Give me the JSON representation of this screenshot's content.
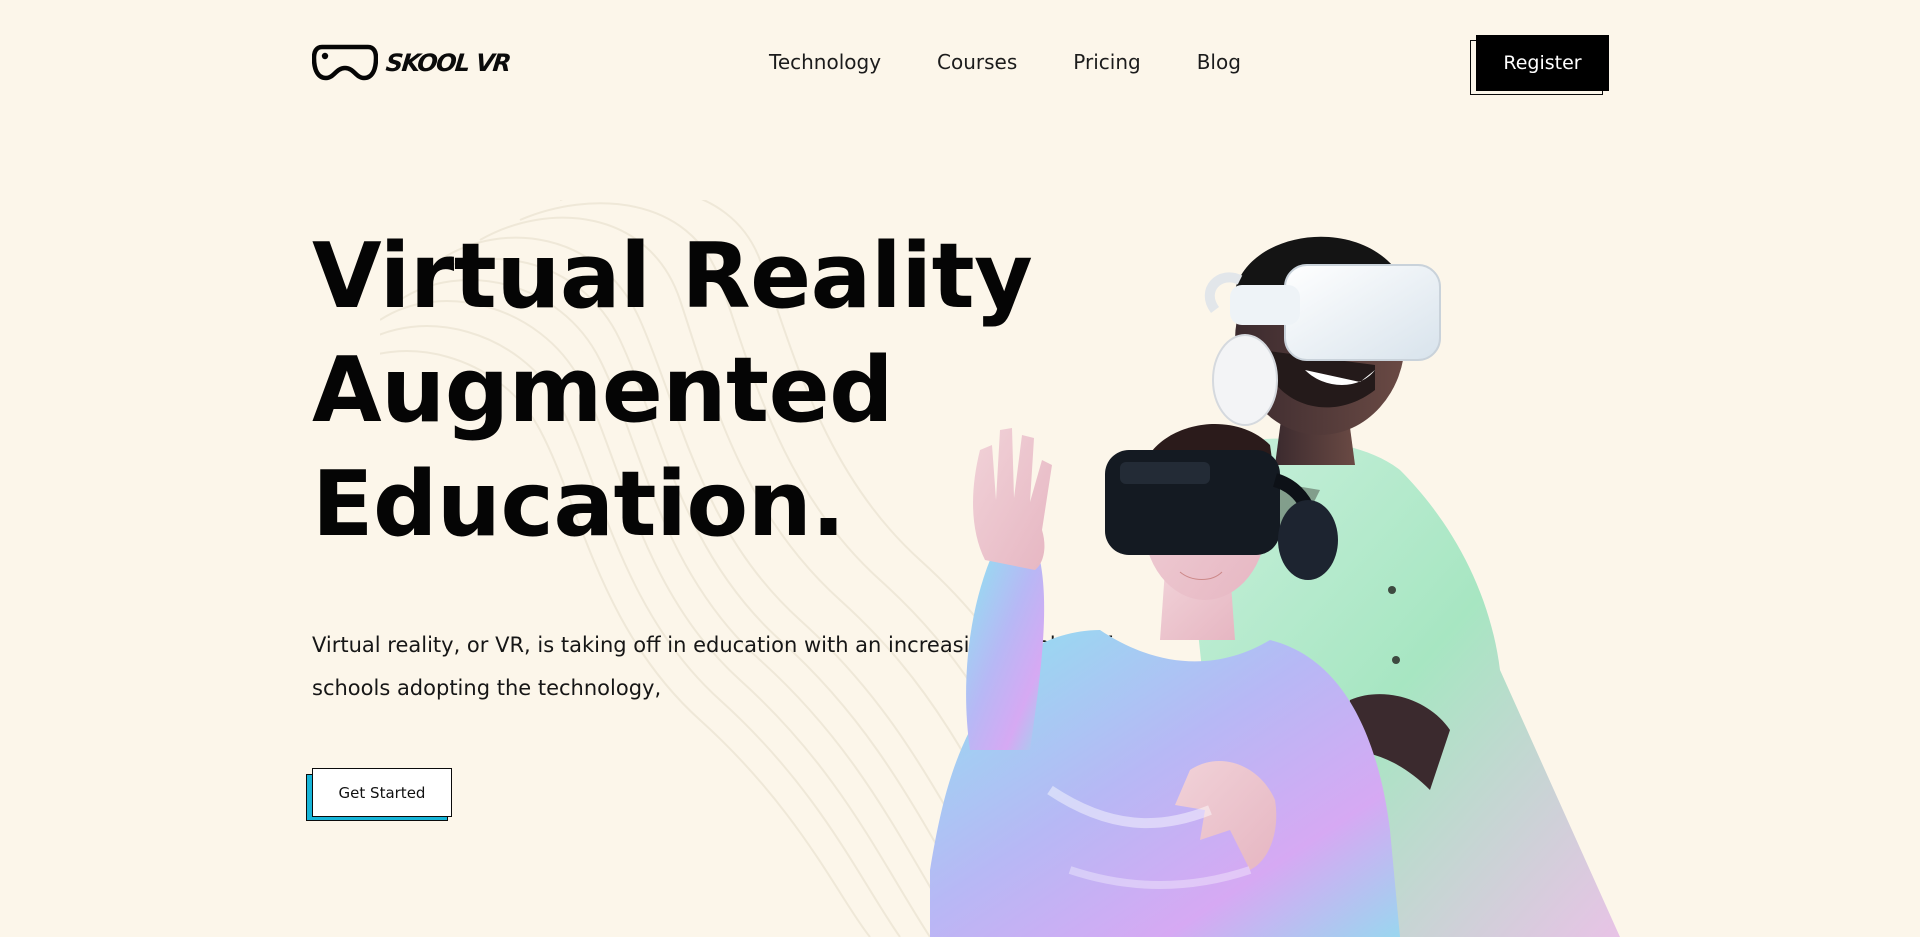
{
  "brand": {
    "name": "SKOOL VR",
    "logo_icon": "vr-headset-icon"
  },
  "nav": {
    "items": [
      {
        "label": "Technology"
      },
      {
        "label": "Courses"
      },
      {
        "label": "Pricing"
      },
      {
        "label": "Blog"
      }
    ]
  },
  "header": {
    "register_label": "Register"
  },
  "hero": {
    "title_lines": [
      "Virtual Reality",
      "Augmented",
      "Education."
    ],
    "description": "Virtual reality, or VR, is taking off in education with an increasing number of schools adopting the technology,",
    "cta_label": "Get Started",
    "image": "two-people-wearing-vr-headsets-photo"
  },
  "colors": {
    "background": "#fcf6ea",
    "text": "#050505",
    "cta_accent": "#17b5d8",
    "register_bg": "#000000"
  }
}
